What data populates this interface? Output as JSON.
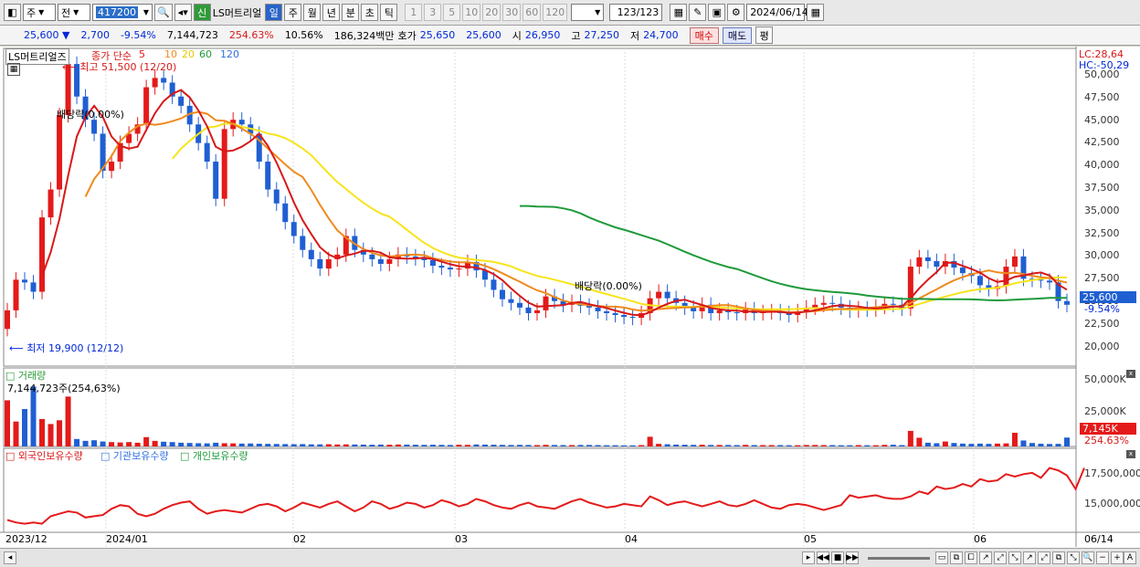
{
  "toolbar": {
    "period_select": "주",
    "market_select": "전",
    "code": "417200",
    "name_badge": "신",
    "stock_name": "LS머트리얼",
    "period_tabs": [
      "일",
      "주",
      "월",
      "년",
      "분",
      "초",
      "틱"
    ],
    "active_tab": "일",
    "interval_buttons": [
      "1",
      "3",
      "5",
      "10",
      "20",
      "30",
      "60",
      "120"
    ],
    "count": "123",
    "count_total": "/123",
    "date": "2024/06/14"
  },
  "info": {
    "price": "25,600 ▼",
    "change": "2,700",
    "change_pct": "-9.54%",
    "volume": "7,144,723",
    "volume_pct": "254.63%",
    "turnover": "10.56%",
    "amount": "186,324백만",
    "ask_label": "호가",
    "ask": "25,650",
    "bid": "25,600",
    "open_label": "시",
    "open": "26,950",
    "high_label": "고",
    "high": "27,250",
    "low_label": "저",
    "low": "24,700",
    "buy": "매수",
    "sell": "매도",
    "eval": "평"
  },
  "price_panel": {
    "name": "LS머트리얼즈",
    "legend_title": "종가 단순",
    "ma_labels": [
      "5",
      "10",
      "20",
      "60",
      "120"
    ],
    "high_note": "최고 51,500 (12/20)",
    "low_note": "최저 19,900 (12/12)",
    "dividend_1": "배당락(0.00%)",
    "dividend_2": "배당락(0.00%)",
    "lc": "LC:28,64",
    "hc": "HC:-50,29",
    "y_ticks": [
      "50,000",
      "47,500",
      "45,000",
      "42,500",
      "40,000",
      "37,500",
      "35,000",
      "32,500",
      "30,000",
      "27,500",
      "25,000",
      "22,500",
      "20,000"
    ],
    "last_price": "25,600",
    "last_pct": "-9.54%"
  },
  "volume_panel": {
    "title": "거래량",
    "value": "7,144,723주(254,63%)",
    "y_ticks": [
      "50,000K",
      "25,000K"
    ],
    "last_volume": "7,145K",
    "last_pct": "254.63%"
  },
  "holdings_panel": {
    "legend": [
      "외국인보유수량",
      "기관보유수량",
      "개인보유수량"
    ],
    "y_ticks": [
      "17,500,000",
      "15,000,000"
    ]
  },
  "x_axis": [
    "2023/12",
    "2024/01",
    "02",
    "03",
    "04",
    "05",
    "06",
    "06/14"
  ],
  "colors": {
    "up": "#e41a1a",
    "down": "#1f5fd2",
    "ma5": "#d81818",
    "ma10": "#f08a1c",
    "ma20": "#f7e41c",
    "ma60": "#1f9a3a",
    "ma120": "#2f6fdf"
  },
  "chart_data": {
    "type": "candlestick",
    "x_axis": [
      "2023/12",
      "2024/01",
      "02",
      "03",
      "04",
      "05",
      "06"
    ],
    "price_range": [
      19900,
      51500
    ],
    "candles_close": [
      25000,
      28300,
      28000,
      27000,
      35000,
      38000,
      46000,
      51500,
      48000,
      45500,
      44000,
      40000,
      41000,
      43000,
      44000,
      45000,
      49000,
      50000,
      49500,
      48000,
      47000,
      45000,
      43000,
      41000,
      37000,
      44500,
      45500,
      45000,
      44000,
      41000,
      38000,
      36500,
      34500,
      33000,
      31500,
      30500,
      29500,
      30500,
      31000,
      33000,
      31500,
      31000,
      30500,
      30000,
      30500,
      31000,
      30800,
      30600,
      30400,
      29800,
      29600,
      29400,
      29500,
      30200,
      29300,
      28300,
      27200,
      26200,
      25800,
      25300,
      24700,
      25000,
      26500,
      26000,
      25600,
      25900,
      25500,
      25300,
      24900,
      24700,
      24500,
      24300,
      24200,
      24700,
      26300,
      27000,
      26300,
      25800,
      25300,
      24900,
      25600,
      24700,
      25000,
      24800,
      24700,
      25100,
      24700,
      24800,
      24900,
      24700,
      24500,
      24900,
      25300,
      25600,
      25800,
      25700,
      25300,
      25000,
      25200,
      25100,
      25400,
      25700,
      25600,
      25200,
      29700,
      30700,
      30300,
      29700,
      30300,
      29600,
      29000,
      28700,
      27700,
      27300,
      27600,
      29700,
      30800,
      28400,
      28300,
      28200,
      28000,
      26000,
      25600
    ],
    "volume_k": [
      37000,
      20000,
      30000,
      48000,
      22000,
      18000,
      21000,
      40000,
      6000,
      4500,
      5000,
      4000,
      3500,
      3200,
      3500,
      3000,
      7500,
      4500,
      3800,
      3500,
      3000,
      2800,
      2600,
      2500,
      3000,
      2600,
      2500,
      2300,
      2400,
      2200,
      2100,
      2000,
      1900,
      1800,
      1900,
      1700,
      1700,
      1800,
      1600,
      1700,
      1600,
      1500,
      1400,
      1500,
      1400,
      1600,
      1500,
      1400,
      1300,
      1400,
      1300,
      1200,
      1400,
      1300,
      1600,
      1500,
      1400,
      1300,
      1200,
      1300,
      1200,
      1100,
      1300,
      1200,
      1100,
      1100,
      1200,
      1200,
      1100,
      1000,
      1000,
      900,
      900,
      1100,
      7800,
      2100,
      1800,
      1500,
      1400,
      1300,
      1400,
      1200,
      1200,
      1200,
      1100,
      1300,
      1100,
      1100,
      1100,
      1100,
      1000,
      1000,
      1200,
      1200,
      1100,
      1100,
      1000,
      1000,
      1100,
      1000,
      1000,
      1300,
      1400,
      1100,
      12500,
      7000,
      3000,
      2600,
      4000,
      2800,
      2300,
      2100,
      2300,
      2100,
      2300,
      2500,
      11000,
      4800,
      2800,
      2200,
      2000,
      2100,
      7145
    ],
    "foreign_holdings": [
      13700000,
      13500000,
      13400000,
      13500000,
      13400000,
      14000000,
      14200000,
      14400000,
      14300000,
      13900000,
      14000000,
      14100000,
      14600000,
      14900000,
      14800000,
      14200000,
      14000000,
      14200000,
      14600000,
      14900000,
      15100000,
      15200000,
      14600000,
      14200000,
      14400000,
      14500000,
      14400000,
      14300000,
      14600000,
      14900000,
      15000000,
      14800000,
      14400000,
      14700000,
      15100000,
      14900000,
      14700000,
      15000000,
      15200000,
      14800000,
      14400000,
      14700000,
      15200000,
      15000000,
      14600000,
      14800000,
      15100000,
      15000000,
      14700000,
      14900000,
      15300000,
      15100000,
      14800000,
      15000000,
      15400000,
      15200000,
      14900000,
      14700000,
      14600000,
      14900000,
      15100000,
      14800000,
      14700000,
      14600000,
      14900000,
      15200000,
      15400000,
      15100000,
      14900000,
      14700000,
      14800000,
      15000000,
      14900000,
      14800000,
      15600000,
      15300000,
      14900000,
      15100000,
      15200000,
      15000000,
      14800000,
      15000000,
      15200000,
      14900000,
      14800000,
      15000000,
      15300000,
      15000000,
      14700000,
      14600000,
      14900000,
      15000000,
      14900000,
      14700000,
      14500000,
      14700000,
      14900000,
      15700000,
      15500000,
      15600000,
      15700000,
      15500000,
      15400000,
      15400000,
      15600000,
      16000000,
      15800000,
      16400000,
      16200000,
      16300000,
      16600000,
      16400000,
      17000000,
      16800000,
      16900000,
      17400000,
      17200000,
      17400000,
      17500000,
      17100000,
      17900000,
      17700000,
      17300000,
      16200000,
      17900000
    ]
  }
}
